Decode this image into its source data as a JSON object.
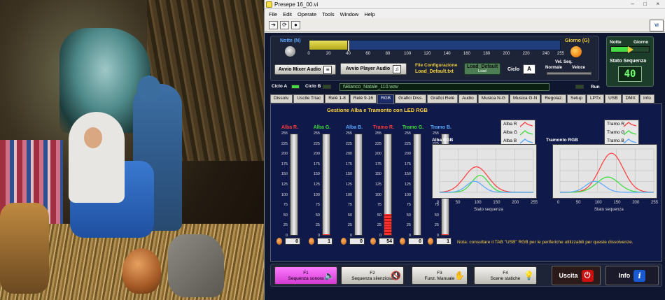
{
  "window": {
    "title": "Presepe 16_00.vi",
    "controls": [
      "–",
      "□",
      "×"
    ]
  },
  "menu": [
    "File",
    "Edit",
    "Operate",
    "Tools",
    "Window",
    "Help"
  ],
  "toolbar": {
    "run_icon": "run-arrow-icon",
    "continuous_icon": "run-continuous-icon",
    "abort_icon": "abort-icon"
  },
  "top": {
    "notte_label": "Notte (N)",
    "giorno_label": "Giorno (G)",
    "slider_value": 40,
    "slider_max": 255,
    "ticks": [
      "0",
      "20",
      "40",
      "60",
      "80",
      "100",
      "120",
      "140",
      "160",
      "180",
      "200",
      "220",
      "240",
      "255"
    ],
    "mixer_button": "Avvio  Mixer Audio",
    "player_button": "Avvio  Player Audio",
    "file_conf_label": "File Configurazione",
    "file_conf_value": "Load_Default.txt",
    "load_default_button": "Load_Default",
    "load_default_sub": "Load",
    "ciclo_label": "Ciclo",
    "ciclo_value": "A",
    "vel_seq_label": "Vel. Seq.",
    "normale_label": "Normale",
    "veloce_label": "Veloce"
  },
  "stato": {
    "notte": "Notte",
    "giorno": "Giorno",
    "label": "Stato Sequenza",
    "value": "40"
  },
  "ciclo_row": {
    "ciclo_a": "Ciclo A",
    "ciclo_b": "Ciclo B",
    "path": "t\\Bianco_Natale_110.wav",
    "run": "Run"
  },
  "tabs": [
    "Dissolv.",
    "Uscite Triac",
    "Relè 1-8",
    "Relè 9-16",
    "RGB",
    "Grafici Diss.",
    "Grafici Relè",
    "Audio",
    "Musica N-G",
    "Musica G-N",
    "Regolaz.",
    "Setup",
    "LPTx",
    "USB",
    "DMX",
    "Info"
  ],
  "active_tab": "RGB",
  "panel": {
    "title": "Gestione Alba e Tramonto con LED RGB",
    "scale": [
      "255",
      "225",
      "200",
      "175",
      "150",
      "125",
      "100",
      "75",
      "50",
      "25",
      "0"
    ],
    "meters": [
      {
        "name": "Alba R.",
        "color": "#ff3a3a",
        "value": 0
      },
      {
        "name": "Alba G.",
        "color": "#3adc3a",
        "value": 1
      },
      {
        "name": "Alba B.",
        "color": "#5aa7ff",
        "value": 0
      },
      {
        "name": "Tramo R.",
        "color": "#ff3a3a",
        "value": 54
      },
      {
        "name": "Tramo G.",
        "color": "#3adc3a",
        "value": 0
      },
      {
        "name": "Tramo B.",
        "color": "#5aa7ff",
        "value": 1
      }
    ],
    "alba_legend": [
      "Alba R",
      "Alba G",
      "Alba B"
    ],
    "tramonto_legend": [
      "Tramo R",
      "Tramo G",
      "Tramo B"
    ],
    "alba_graph_title": "Alba RGB",
    "tramonto_graph_title": "Tramonto RGB",
    "x_ticks": [
      "0",
      "50",
      "100",
      "150",
      "200",
      "255"
    ],
    "x_label": "Stato sequenza",
    "note": "Nota: consultare il TAB \"USB\" RGB per le periferiche utilizzabili per queste dissolvenze."
  },
  "footer": {
    "f1": {
      "key": "F1",
      "label": "Sequenza sonora",
      "icon": "speaker-icon"
    },
    "f2": {
      "key": "F2",
      "label": "Sequenza silenziosa",
      "icon": "speaker-muted-icon"
    },
    "f3": {
      "key": "F3",
      "label": "Funz. Manuale",
      "icon": "hand-icon"
    },
    "f4": {
      "key": "F4",
      "label": "Scene statiche",
      "icon": "lightbulb-icon"
    },
    "uscita": "Uscita",
    "info": "Info"
  },
  "colors": {
    "red": "#ff3a3a",
    "green": "#3adc3a",
    "blue": "#5aa7ff",
    "panel_bg": "#101a4a",
    "accent_yellow": "#ffd23c"
  }
}
